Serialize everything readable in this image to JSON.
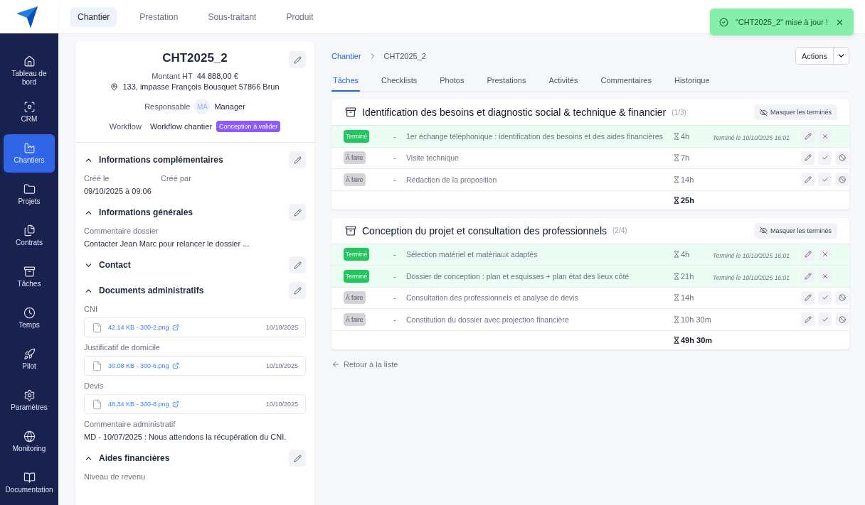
{
  "top_tabs": [
    {
      "label": "Chantier",
      "selected": true
    },
    {
      "label": "Prestation",
      "selected": false
    },
    {
      "label": "Sous-traitant",
      "selected": false
    },
    {
      "label": "Produit",
      "selected": false
    }
  ],
  "toast": {
    "message": "\"CHT2025_2\" mise à jour !"
  },
  "sidebar": {
    "items": [
      {
        "label": "Tableau de bord",
        "selected": false
      },
      {
        "label": "CRM",
        "selected": false
      },
      {
        "label": "Chantiers",
        "selected": true
      },
      {
        "label": "Projets",
        "selected": false
      },
      {
        "label": "Contrats",
        "selected": false
      },
      {
        "label": "Tâches",
        "selected": false
      },
      {
        "label": "Temps",
        "selected": false
      },
      {
        "label": "Pilot",
        "selected": false
      },
      {
        "label": "Paramètres",
        "selected": false
      },
      {
        "label": "Monitoring",
        "selected": false
      },
      {
        "label": "Documentation",
        "selected": false
      }
    ]
  },
  "record": {
    "title": "CHT2025_2",
    "amount_label": "Montant HT",
    "amount": "44 888,00 €",
    "address": "133, impasse François Bousquet 57866 Brun",
    "manager_label": "Responsable",
    "manager_initials": "MA",
    "manager_name": "Manager",
    "workflow_label": "Workflow",
    "workflow": "Workflow chantier",
    "workflow_status": "Conception à valider"
  },
  "sections": [
    {
      "title": "Informations complémentaires",
      "expanded": true,
      "items": [
        {
          "kind": "columns",
          "columns": [
            {
              "label": "Créé le",
              "value": "09/10/2025 à 09:06"
            },
            {
              "label": "Créé par"
            }
          ]
        }
      ]
    },
    {
      "title": "Informations générales",
      "expanded": true,
      "items": [
        {
          "kind": "field",
          "label": "Commentaire dossier",
          "value": "Contacter Jean Marc pour relancer le dossier ..."
        }
      ]
    },
    {
      "title": "Contact",
      "expanded": false
    },
    {
      "title": "Documents administratifs",
      "expanded": true,
      "items": [
        {
          "kind": "document",
          "label": "CNI",
          "file": "42.14 KB - 300-2.png",
          "date": "10/10/2025"
        },
        {
          "kind": "document",
          "label": "Justificatif de domicile",
          "file": "30.08 KB - 300-6.png",
          "date": "10/10/2025"
        },
        {
          "kind": "document",
          "label": "Devis",
          "file": "48.34 KB - 300-8.png",
          "date": "10/10/2025"
        },
        {
          "kind": "field",
          "label": "Commentaire administratif",
          "value": "MD - 10/07/2025 : Nous attendons la récupération du CNI."
        }
      ]
    },
    {
      "title": "Aides financières",
      "expanded": true,
      "items": [
        {
          "kind": "field",
          "label": "Niveau de revenu"
        }
      ]
    }
  ],
  "breadcrumb": [
    "Chantier",
    "CHT2025_2"
  ],
  "actions_button": "Actions",
  "tabs": [
    {
      "label": "Tâches",
      "selected": true
    },
    {
      "label": "Checklists",
      "selected": false
    },
    {
      "label": "Photos",
      "selected": false
    },
    {
      "label": "Prestations",
      "selected": false
    },
    {
      "label": "Activités",
      "selected": false
    },
    {
      "label": "Commentaires",
      "selected": false
    },
    {
      "label": "Historique",
      "selected": false
    }
  ],
  "task_groups": [
    {
      "title": "Identification des besoins et diagnostic social & technique & financier",
      "count": "(1/3)",
      "hide_button": "Masquer les terminés",
      "total": "25h",
      "tasks": [
        {
          "kind": "done",
          "status_label": "Terminé",
          "dash": "-",
          "title": "1er échange téléphonique : identification des besoins et des aides financières",
          "duration": "4h",
          "completed": "Terminé le 10/10/2025 16:01"
        },
        {
          "kind": "todo",
          "status_label": "À faire",
          "dash": "-",
          "title": "Visite technique",
          "duration": "7h"
        },
        {
          "kind": "todo",
          "status_label": "À faire",
          "dash": "-",
          "title": "Rédaction de la proposition",
          "duration": "14h"
        }
      ]
    },
    {
      "title": "Conception du projet et consultation des professionnels",
      "count": "(2/4)",
      "hide_button": "Masquer les terminés",
      "total": "49h 30m",
      "tasks": [
        {
          "kind": "done",
          "status_label": "Terminé",
          "dash": "-",
          "title": "Sélection matériel et matériaux adaptés",
          "duration": "4h",
          "completed": "Terminé le 10/10/2025 16:01"
        },
        {
          "kind": "done",
          "status_label": "Terminé",
          "dash": "-",
          "title": "Dossier de conception : plan et esquisses + plan état des lieux côté",
          "duration": "21h",
          "completed": "Terminé le 10/10/2025 16:01"
        },
        {
          "kind": "todo",
          "status_label": "À faire",
          "dash": "-",
          "title": "Consultation des professionnels et analyse de devis",
          "duration": "14h"
        },
        {
          "kind": "todo",
          "status_label": "À faire",
          "dash": "-",
          "title": "Constitution du dossier avec projection financière",
          "duration": "10h 30m"
        }
      ]
    }
  ],
  "back_link": "Retour à la liste"
}
